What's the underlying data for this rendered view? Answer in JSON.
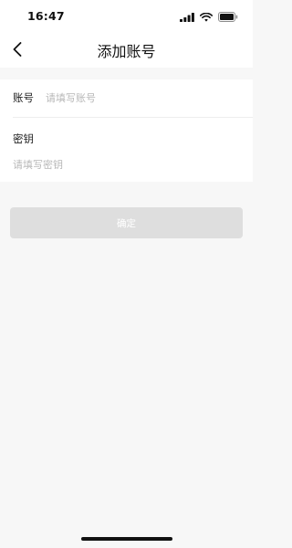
{
  "status_bar": {
    "time": "16:47",
    "icons": [
      "cellular-signal-icon",
      "wifi-icon",
      "battery-icon"
    ]
  },
  "nav": {
    "back_icon": "chevron-left-icon",
    "title": "添加账号"
  },
  "form": {
    "account_label": "账号",
    "account_placeholder": "请填写账号",
    "account_value": "",
    "secret_label": "密钥",
    "secret_placeholder": "请填写密钥",
    "secret_value": ""
  },
  "confirm_button": {
    "label": "确定",
    "enabled": false
  },
  "colors": {
    "page_background": "#f7f7f7",
    "card_background": "#ffffff",
    "placeholder_text": "#b8b8b8",
    "button_disabled_background": "#dedede",
    "button_text": "#ffffff"
  }
}
